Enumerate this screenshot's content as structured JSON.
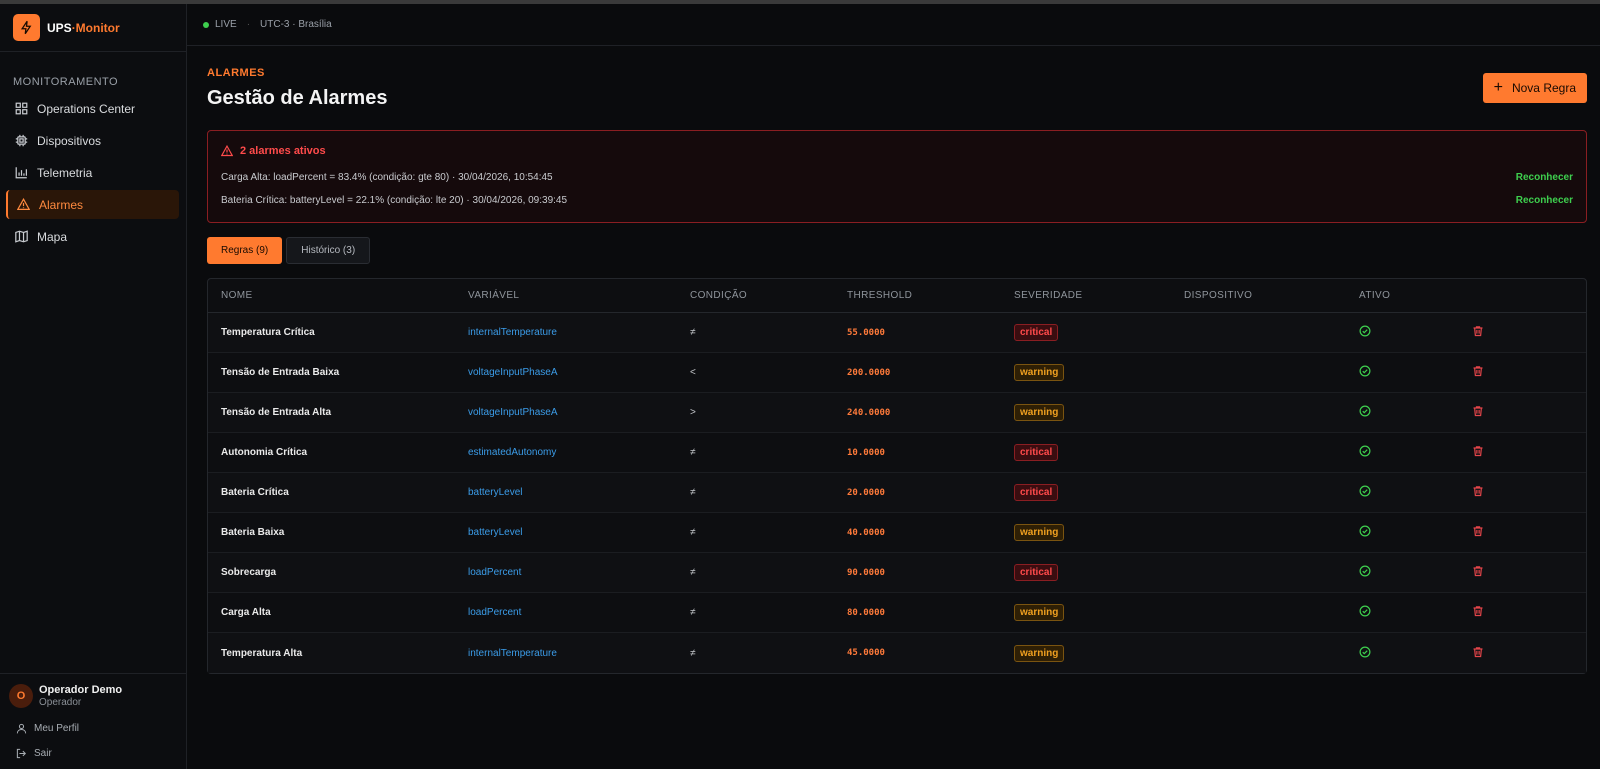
{
  "brand": {
    "name_main": "UPS",
    "name_accent": "·Monitor",
    "icon": "bolt-icon"
  },
  "sidebar": {
    "section_title": "MONITORAMENTO",
    "items": [
      {
        "label": "Operations Center",
        "icon": "grid-icon"
      },
      {
        "label": "Dispositivos",
        "icon": "chip-icon"
      },
      {
        "label": "Telemetria",
        "icon": "bar-chart-icon"
      },
      {
        "label": "Alarmes",
        "icon": "warning-icon",
        "active": true
      },
      {
        "label": "Mapa",
        "icon": "map-icon"
      }
    ],
    "user": {
      "initial": "O",
      "name": "Operador Demo",
      "role": "Operador"
    },
    "profile_label": "Meu Perfil",
    "logout_label": "Sair"
  },
  "topbar": {
    "live_label": "LIVE",
    "separator": "·",
    "timezone": "UTC-3 · Brasília"
  },
  "header": {
    "eyebrow": "ALARMES",
    "title": "Gestão de Alarmes",
    "new_rule_label": "Nova Regra"
  },
  "active_alarms": {
    "title": "2 alarmes ativos",
    "items": [
      {
        "text": "Carga Alta: loadPercent = 83.4% (condição: gte 80) · 30/04/2026, 10:54:45",
        "action": "Reconhecer"
      },
      {
        "text": "Bateria Crítica: batteryLevel = 22.1% (condição: lte 20) · 30/04/2026, 09:39:45",
        "action": "Reconhecer"
      }
    ]
  },
  "tabs": [
    {
      "label": "Regras (9)",
      "active": true
    },
    {
      "label": "Histórico (3)",
      "active": false
    }
  ],
  "table": {
    "columns": [
      "NOME",
      "VARIÁVEL",
      "CONDIÇÃO",
      "THRESHOLD",
      "SEVERIDADE",
      "DISPOSITIVO",
      "ATIVO"
    ],
    "rows": [
      {
        "name": "Temperatura Crítica",
        "variable": "internalTemperature",
        "condition": "≠",
        "threshold": "55.0000",
        "severity": "critical",
        "device": ""
      },
      {
        "name": "Tensão de Entrada Baixa",
        "variable": "voltageInputPhaseA",
        "condition": "<",
        "threshold": "200.0000",
        "severity": "warning",
        "device": ""
      },
      {
        "name": "Tensão de Entrada Alta",
        "variable": "voltageInputPhaseA",
        "condition": ">",
        "threshold": "240.0000",
        "severity": "warning",
        "device": ""
      },
      {
        "name": "Autonomia Crítica",
        "variable": "estimatedAutonomy",
        "condition": "≠",
        "threshold": "10.0000",
        "severity": "critical",
        "device": ""
      },
      {
        "name": "Bateria Crítica",
        "variable": "batteryLevel",
        "condition": "≠",
        "threshold": "20.0000",
        "severity": "critical",
        "device": ""
      },
      {
        "name": "Bateria Baixa",
        "variable": "batteryLevel",
        "condition": "≠",
        "threshold": "40.0000",
        "severity": "warning",
        "device": ""
      },
      {
        "name": "Sobrecarga",
        "variable": "loadPercent",
        "condition": "≠",
        "threshold": "90.0000",
        "severity": "critical",
        "device": ""
      },
      {
        "name": "Carga Alta",
        "variable": "loadPercent",
        "condition": "≠",
        "threshold": "80.0000",
        "severity": "warning",
        "device": ""
      },
      {
        "name": "Temperatura Alta",
        "variable": "internalTemperature",
        "condition": "≠",
        "threshold": "45.0000",
        "severity": "warning",
        "device": ""
      }
    ]
  },
  "colors": {
    "accent": "#ff7a2f",
    "critical": "#ff4b4b",
    "warning": "#f0a020",
    "ok": "#3ecf4e",
    "link": "#3b9ce8"
  }
}
